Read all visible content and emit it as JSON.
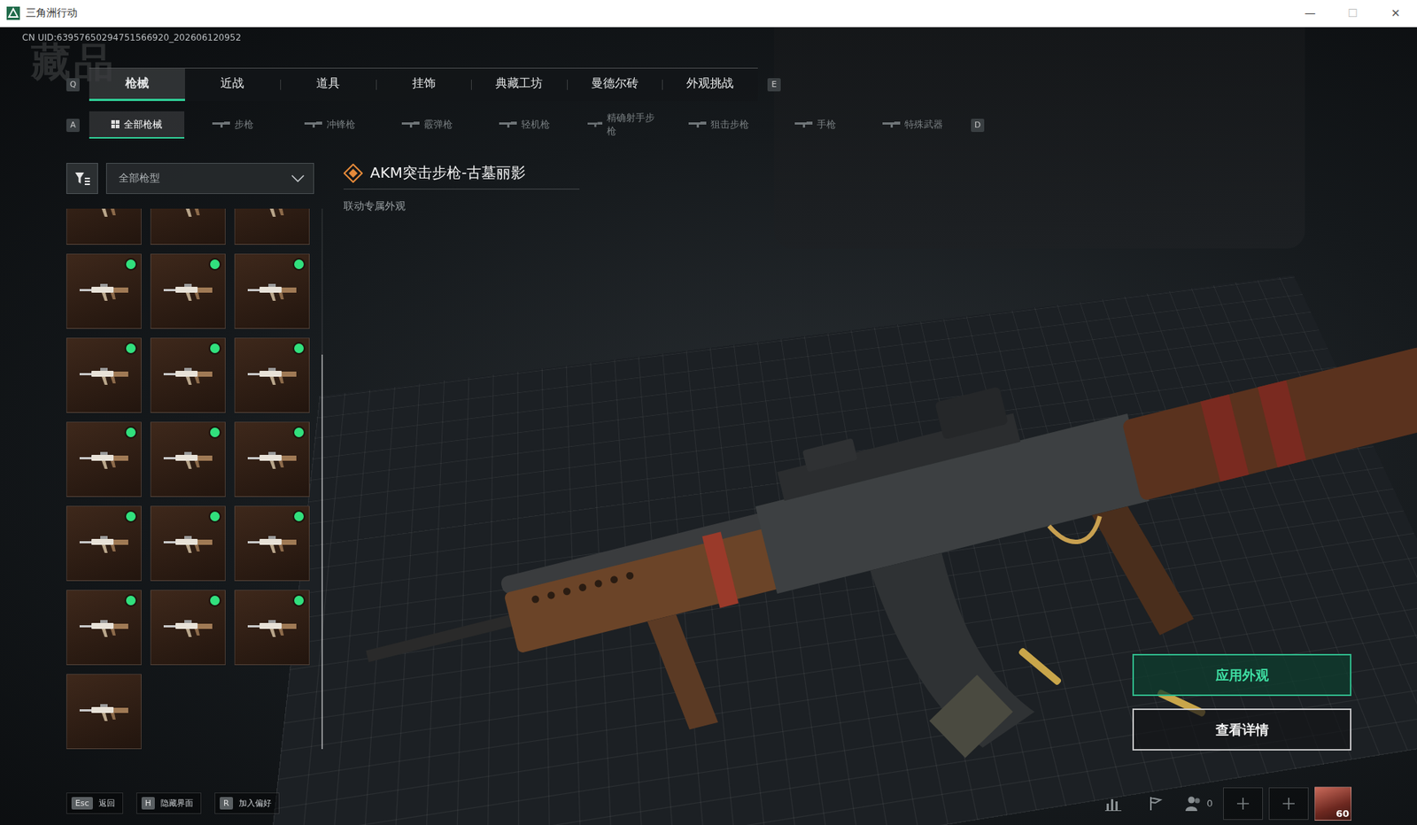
{
  "window": {
    "title": "三角洲行动",
    "controls": [
      "—",
      "☐",
      "✕"
    ]
  },
  "uid": "CN UID:63957650294751566920_202606120952",
  "heading": "藏品",
  "tabs": {
    "prev_key": "Q",
    "next_key": "E",
    "items": [
      {
        "label": "枪械",
        "selected": true
      },
      {
        "label": "近战",
        "selected": false
      },
      {
        "label": "道具",
        "selected": false
      },
      {
        "label": "挂饰",
        "selected": false
      },
      {
        "label": "典藏工坊",
        "selected": false
      },
      {
        "label": "曼德尔砖",
        "selected": false
      },
      {
        "label": "外观挑战",
        "selected": false
      }
    ]
  },
  "subtabs": {
    "prev_key": "A",
    "next_key": "D",
    "items": [
      {
        "label": "全部枪械",
        "selected": true,
        "kind": "all"
      },
      {
        "label": "步枪",
        "selected": false,
        "kind": "gun"
      },
      {
        "label": "冲锋枪",
        "selected": false,
        "kind": "gun"
      },
      {
        "label": "霰弹枪",
        "selected": false,
        "kind": "gun"
      },
      {
        "label": "轻机枪",
        "selected": false,
        "kind": "gun"
      },
      {
        "label": "精确射手步枪",
        "selected": false,
        "kind": "gun"
      },
      {
        "label": "狙击步枪",
        "selected": false,
        "kind": "gun"
      },
      {
        "label": "手枪",
        "selected": false,
        "kind": "gun"
      },
      {
        "label": "特殊武器",
        "selected": false,
        "kind": "gun"
      }
    ]
  },
  "filter": {
    "value": "全部枪型"
  },
  "items": [
    {
      "owned": true
    },
    {
      "owned": true
    },
    {
      "owned": true
    },
    {
      "owned": true
    },
    {
      "owned": true
    },
    {
      "owned": true
    },
    {
      "owned": true
    },
    {
      "owned": true
    },
    {
      "owned": true
    },
    {
      "owned": true
    },
    {
      "owned": true
    },
    {
      "owned": true
    },
    {
      "owned": true
    },
    {
      "owned": true
    },
    {
      "owned": true
    },
    {
      "owned": true
    },
    {
      "owned": true
    },
    {
      "owned": true
    },
    {
      "owned": false
    }
  ],
  "scroll": {
    "position": 1,
    "visible_share": 0.73
  },
  "detail": {
    "name": "AKM突击步枪-古墓丽影",
    "tag": "联动专属外观"
  },
  "actions": [
    {
      "label": "应用外观",
      "primary": true
    },
    {
      "label": "查看详情",
      "primary": false
    }
  ],
  "hints": [
    {
      "key": "Esc",
      "label": "返回"
    },
    {
      "key": "H",
      "label": "隐藏界面"
    },
    {
      "key": "R",
      "label": "加入偏好"
    }
  ],
  "status": {
    "friends": "0",
    "level": "60"
  }
}
